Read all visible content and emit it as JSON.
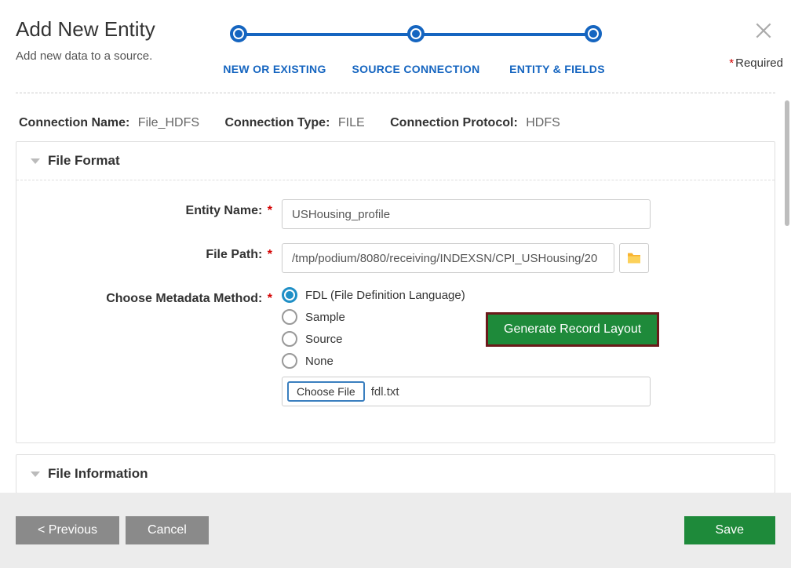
{
  "header": {
    "title": "Add New Entity",
    "subtitle": "Add new data to a source.",
    "required_label": "Required"
  },
  "stepper": {
    "step1": "NEW OR EXISTING",
    "step2": "SOURCE CONNECTION",
    "step3": "ENTITY & FIELDS"
  },
  "connection": {
    "name_label": "Connection Name:",
    "name_value": "File_HDFS",
    "type_label": "Connection Type:",
    "type_value": "FILE",
    "protocol_label": "Connection Protocol:",
    "protocol_value": "HDFS"
  },
  "panels": {
    "file_format_title": "File Format",
    "file_info_title": "File Information"
  },
  "form": {
    "entity_name_label": "Entity Name:",
    "entity_name_value": "USHousing_profile",
    "file_path_label": "File Path:",
    "file_path_value": "/tmp/podium/8080/receiving/INDEXSN/CPI_USHousing/20",
    "metadata_label": "Choose Metadata Method:",
    "radio_fdl": "FDL (File Definition Language)",
    "radio_sample": "Sample",
    "radio_source": "Source",
    "radio_none": "None",
    "generate_btn": "Generate Record Layout",
    "choose_file_btn": "Choose File",
    "choose_file_name": "fdl.txt"
  },
  "footer": {
    "previous": "< Previous",
    "cancel": "Cancel",
    "save": "Save"
  }
}
